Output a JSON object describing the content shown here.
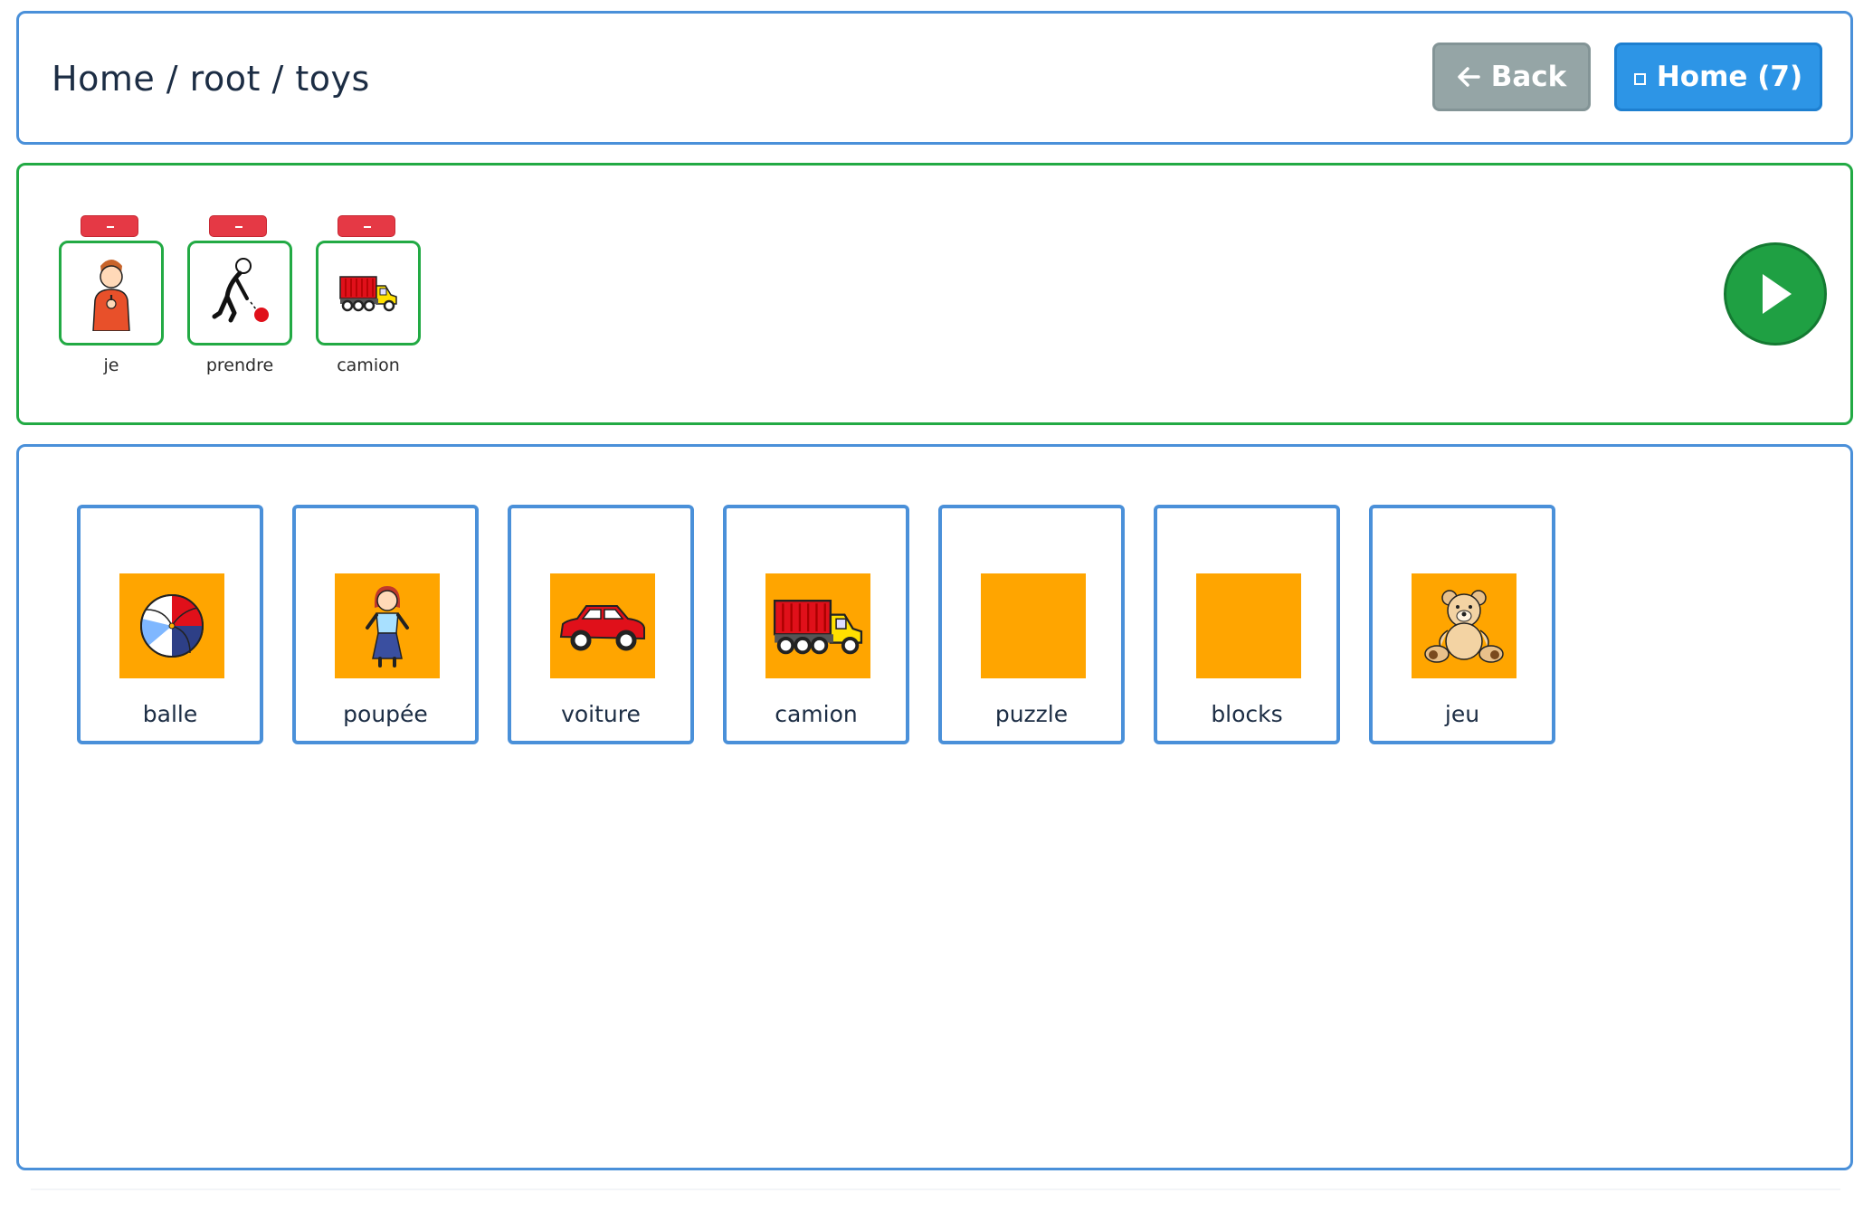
{
  "header": {
    "breadcrumb": "Home / root / toys",
    "back_icon": "arrow-left-icon",
    "back_label": "Back",
    "home_icon": "square-icon",
    "home_label": "Home (7)",
    "colors": {
      "back": "#95a5a6",
      "home": "#2d95e6"
    }
  },
  "sentence": {
    "items": [
      {
        "label": "je",
        "icon": "person-pointing-self-icon"
      },
      {
        "label": "prendre",
        "icon": "person-picking-up-ball-icon"
      },
      {
        "label": "camion",
        "icon": "dump-truck-icon"
      }
    ],
    "play_icon": "play-icon",
    "colors": {
      "border": "#22aa44",
      "remove": "#e53945",
      "play": "#1fa043"
    }
  },
  "board": {
    "tiles": [
      {
        "label": "balle",
        "icon": "beach-ball-icon"
      },
      {
        "label": "poupée",
        "icon": "doll-icon"
      },
      {
        "label": "voiture",
        "icon": "red-car-icon"
      },
      {
        "label": "camion",
        "icon": "dump-truck-icon"
      },
      {
        "label": "puzzle",
        "icon": ""
      },
      {
        "label": "blocks",
        "icon": ""
      },
      {
        "label": "jeu",
        "icon": "teddy-bear-icon"
      }
    ],
    "colors": {
      "border": "#4a90d9",
      "tile_background": "#ffa500"
    }
  }
}
